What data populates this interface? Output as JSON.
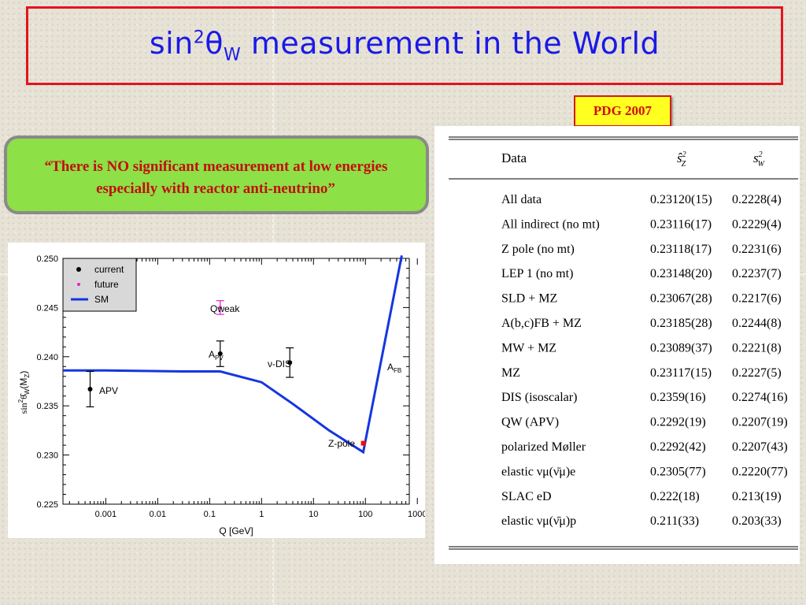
{
  "slide": {
    "title": {
      "base": "sin",
      "sup": "2",
      "theta": "θ",
      "sub": "W",
      "rest": " measurement in the World"
    },
    "badge": "PDG 2007",
    "quote": {
      "open_mark": "“",
      "text": "There is NO significant measurement at low energies especially with reactor anti-neutrino”"
    }
  },
  "plot": {
    "xlabel": "Q [GeV]",
    "ylabel_base": "sin",
    "ylabel_rest": "(M",
    "ylabel_close": ")",
    "x_ticks": [
      "0.001",
      "0.01",
      "0.1",
      "1",
      "10",
      "100",
      "1000"
    ],
    "y_ticks": [
      "0.225",
      "0.230",
      "0.235",
      "0.240",
      "0.245",
      "0.250"
    ],
    "legend": {
      "current": "current",
      "future": "future",
      "sm": "SM"
    },
    "annotations": {
      "apv": "APV",
      "qweak": "Qweak",
      "apv_slac": "A",
      "apv_slac_sub": "PV",
      "nudis": "ν-DIS",
      "zpole": "Z-pole",
      "afb": "A",
      "afb_sub": "FB"
    }
  },
  "chart_data": {
    "type": "scatter",
    "xlabel": "Q [GeV]",
    "ylabel": "sin²θ̂W(MZ)",
    "x_scale": "log",
    "xlim": [
      0.00015,
      700
    ],
    "ylim": [
      0.225,
      0.25
    ],
    "grid": false,
    "legend_position": "top-left",
    "series": [
      {
        "name": "current",
        "points": [
          {
            "label": "APV",
            "x": 0.0005,
            "y": 0.2367,
            "err": 0.0018
          },
          {
            "label": "APV",
            "x": 0.16,
            "y": 0.2403,
            "err": 0.0013
          },
          {
            "label": "ν-DIS",
            "x": 3.5,
            "y": 0.2394,
            "err": 0.0015
          },
          {
            "label": "AFB",
            "x": 1800,
            "y": 0.2388,
            "err": 0.005
          }
        ]
      },
      {
        "name": "future",
        "points": [
          {
            "label": "Qweak",
            "x": 0.16,
            "y": 0.245,
            "err": 0.0007
          }
        ]
      },
      {
        "name": "Z-pole",
        "points": [
          {
            "label": "Z-pole",
            "x": 91.2,
            "y": 0.2312,
            "err": 0.0001
          }
        ]
      },
      {
        "name": "SM",
        "type": "line",
        "points": [
          [
            0.00015,
            0.2386
          ],
          [
            0.001,
            0.2386
          ],
          [
            0.03,
            0.2385
          ],
          [
            0.16,
            0.2385
          ],
          [
            1,
            0.2374
          ],
          [
            4,
            0.2352
          ],
          [
            20,
            0.2325
          ],
          [
            91,
            0.2303
          ],
          [
            500,
            0.2503
          ]
        ]
      }
    ]
  },
  "table": {
    "columns": [
      "Data",
      "ŝ²Z",
      "s²W"
    ],
    "rows": [
      {
        "data": "All data",
        "sz": "0.23120(15)",
        "sw": "0.2228(4)"
      },
      {
        "data": "All indirect (no mt)",
        "sz": "0.23116(17)",
        "sw": "0.2229(4)"
      },
      {
        "data": "Z pole (no mt)",
        "sz": "0.23118(17)",
        "sw": "0.2231(6)"
      },
      {
        "data": "LEP 1 (no mt)",
        "sz": "0.23148(20)",
        "sw": "0.2237(7)"
      },
      {
        "data": "SLD + MZ",
        "sz": "0.23067(28)",
        "sw": "0.2217(6)"
      },
      {
        "data": "A(b,c)FB + MZ",
        "sz": "0.23185(28)",
        "sw": "0.2244(8)"
      },
      {
        "data": "MW + MZ",
        "sz": "0.23089(37)",
        "sw": "0.2221(8)"
      },
      {
        "data": "MZ",
        "sz": "0.23117(15)",
        "sw": "0.2227(5)"
      },
      {
        "data": "DIS (isoscalar)",
        "sz": "0.2359(16)",
        "sw": "0.2274(16)"
      },
      {
        "data": "QW (APV)",
        "sz": "0.2292(19)",
        "sw": "0.2207(19)"
      },
      {
        "data": "polarized Møller",
        "sz": "0.2292(42)",
        "sw": "0.2207(43)"
      },
      {
        "data": "elastic νμ(ν̄μ)e",
        "sz": "0.2305(77)",
        "sw": "0.2220(77)"
      },
      {
        "data": "SLAC eD",
        "sz": "0.222(18)",
        "sw": "0.213(19)"
      },
      {
        "data": "elastic νμ(ν̄μ)p",
        "sz": "0.211(33)",
        "sw": "0.203(33)"
      }
    ]
  },
  "colors": {
    "title_text": "#1a1ae6",
    "title_border": "#e2141f",
    "badge_bg": "#ffff20",
    "badge_text": "#d20c0c",
    "quote_bg": "#8de046",
    "quote_text": "#c20f0f",
    "sm_line": "#1436e0",
    "future_marker": "#e020d0",
    "zpole_marker": "#ff0000"
  }
}
